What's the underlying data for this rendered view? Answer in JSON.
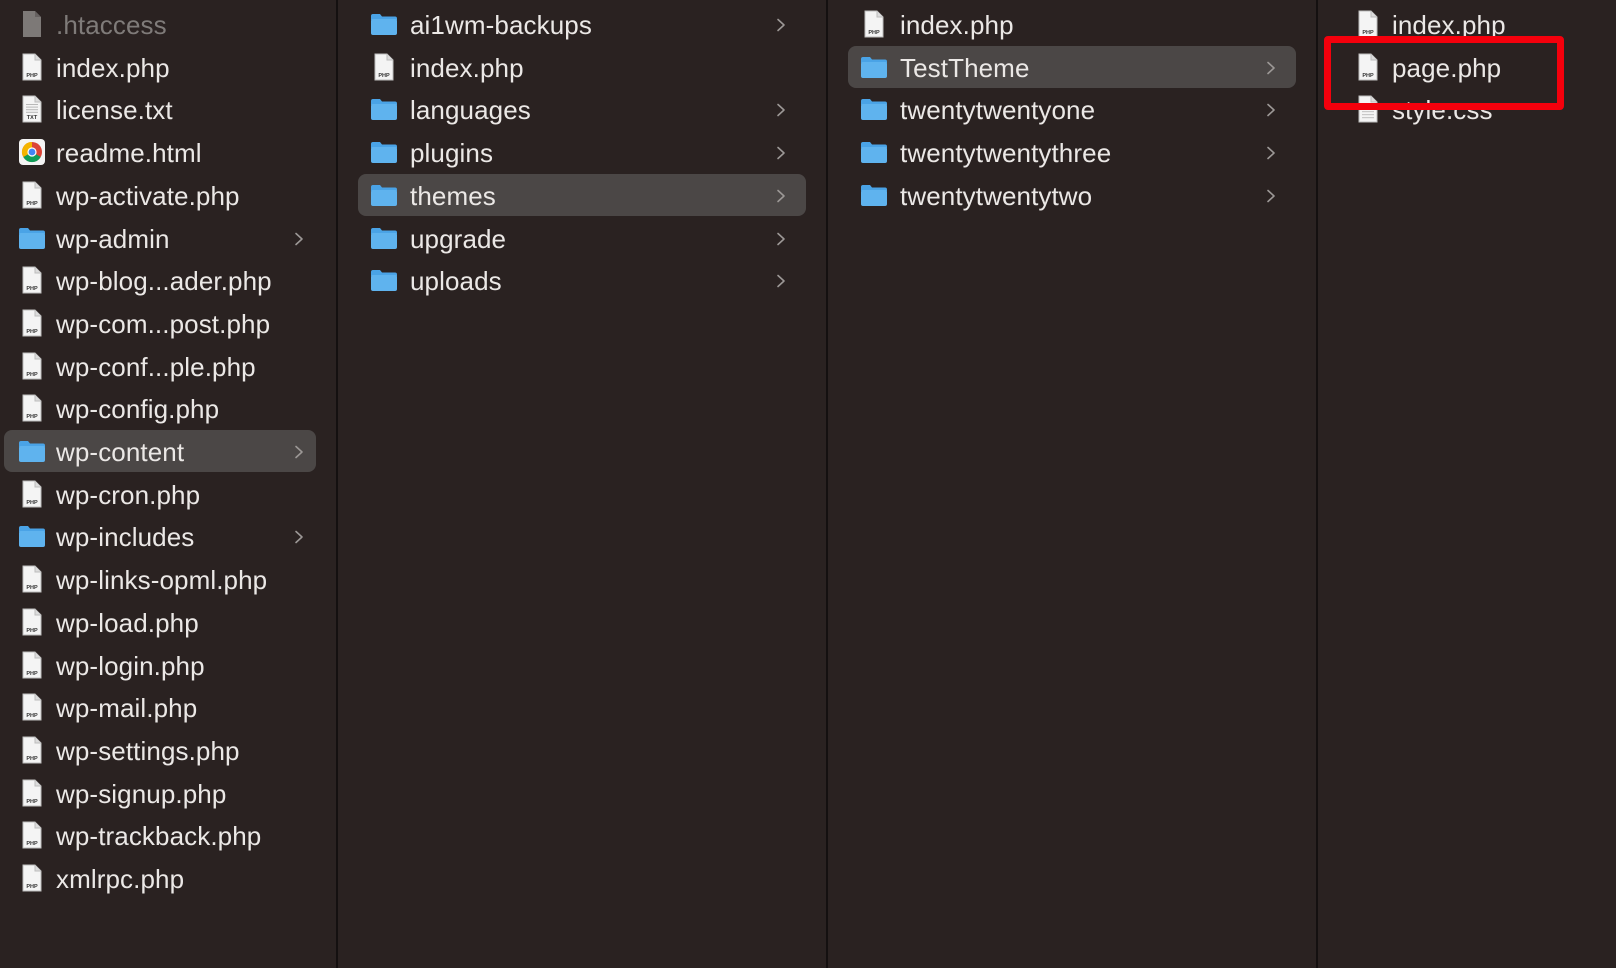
{
  "colors": {
    "background": "#2a2221",
    "selected_row": "#4b4746",
    "folder": "#5fb3ee",
    "annotation": "#f4000c"
  },
  "columns": [
    {
      "items": [
        {
          "label": ".htaccess",
          "icon": "generic-file-icon",
          "type": "file",
          "dimmed": true
        },
        {
          "label": "index.php",
          "icon": "php-file-icon",
          "type": "file"
        },
        {
          "label": "license.txt",
          "icon": "txt-file-icon",
          "type": "file"
        },
        {
          "label": "readme.html",
          "icon": "chrome-icon",
          "type": "file"
        },
        {
          "label": "wp-activate.php",
          "icon": "php-file-icon",
          "type": "file"
        },
        {
          "label": "wp-admin",
          "icon": "folder-icon",
          "type": "folder"
        },
        {
          "label": "wp-blog...ader.php",
          "icon": "php-file-icon",
          "type": "file"
        },
        {
          "label": "wp-com...post.php",
          "icon": "php-file-icon",
          "type": "file"
        },
        {
          "label": "wp-conf...ple.php",
          "icon": "php-file-icon",
          "type": "file"
        },
        {
          "label": "wp-config.php",
          "icon": "php-file-icon",
          "type": "file"
        },
        {
          "label": "wp-content",
          "icon": "folder-icon",
          "type": "folder",
          "selected": true
        },
        {
          "label": "wp-cron.php",
          "icon": "php-file-icon",
          "type": "file"
        },
        {
          "label": "wp-includes",
          "icon": "folder-icon",
          "type": "folder"
        },
        {
          "label": "wp-links-opml.php",
          "icon": "php-file-icon",
          "type": "file"
        },
        {
          "label": "wp-load.php",
          "icon": "php-file-icon",
          "type": "file"
        },
        {
          "label": "wp-login.php",
          "icon": "php-file-icon",
          "type": "file"
        },
        {
          "label": "wp-mail.php",
          "icon": "php-file-icon",
          "type": "file"
        },
        {
          "label": "wp-settings.php",
          "icon": "php-file-icon",
          "type": "file"
        },
        {
          "label": "wp-signup.php",
          "icon": "php-file-icon",
          "type": "file"
        },
        {
          "label": "wp-trackback.php",
          "icon": "php-file-icon",
          "type": "file"
        },
        {
          "label": "xmlrpc.php",
          "icon": "php-file-icon",
          "type": "file"
        }
      ]
    },
    {
      "items": [
        {
          "label": "ai1wm-backups",
          "icon": "folder-icon",
          "type": "folder"
        },
        {
          "label": "index.php",
          "icon": "php-file-icon",
          "type": "file"
        },
        {
          "label": "languages",
          "icon": "folder-icon",
          "type": "folder"
        },
        {
          "label": "plugins",
          "icon": "folder-icon",
          "type": "folder"
        },
        {
          "label": "themes",
          "icon": "folder-icon",
          "type": "folder",
          "selected": true
        },
        {
          "label": "upgrade",
          "icon": "folder-icon",
          "type": "folder"
        },
        {
          "label": "uploads",
          "icon": "folder-icon",
          "type": "folder"
        }
      ]
    },
    {
      "items": [
        {
          "label": "index.php",
          "icon": "php-file-icon",
          "type": "file"
        },
        {
          "label": "TestTheme",
          "icon": "folder-icon",
          "type": "folder",
          "selected": true
        },
        {
          "label": "twentytwentyone",
          "icon": "folder-icon",
          "type": "folder"
        },
        {
          "label": "twentytwentythree",
          "icon": "folder-icon",
          "type": "folder"
        },
        {
          "label": "twentytwentytwo",
          "icon": "folder-icon",
          "type": "folder"
        }
      ]
    },
    {
      "items": [
        {
          "label": "index.php",
          "icon": "php-file-icon",
          "type": "file"
        },
        {
          "label": "page.php",
          "icon": "php-file-icon",
          "type": "file",
          "annotated": true
        },
        {
          "label": "style.css",
          "icon": "css-file-icon",
          "type": "file"
        }
      ]
    }
  ]
}
